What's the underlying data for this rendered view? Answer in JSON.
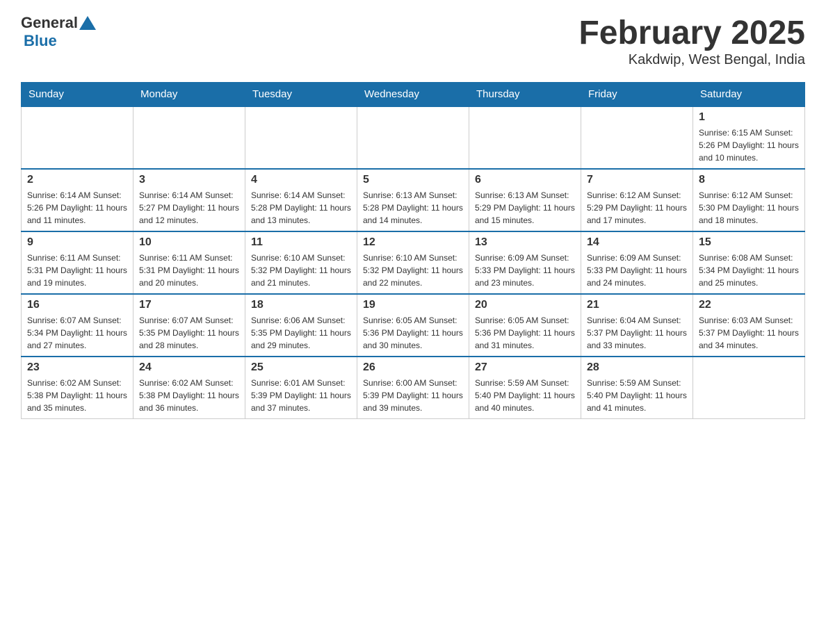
{
  "header": {
    "logo_general": "General",
    "logo_blue": "Blue",
    "title": "February 2025",
    "subtitle": "Kakdwip, West Bengal, India"
  },
  "weekdays": [
    "Sunday",
    "Monday",
    "Tuesday",
    "Wednesday",
    "Thursday",
    "Friday",
    "Saturday"
  ],
  "weeks": [
    [
      {
        "day": "",
        "info": ""
      },
      {
        "day": "",
        "info": ""
      },
      {
        "day": "",
        "info": ""
      },
      {
        "day": "",
        "info": ""
      },
      {
        "day": "",
        "info": ""
      },
      {
        "day": "",
        "info": ""
      },
      {
        "day": "1",
        "info": "Sunrise: 6:15 AM\nSunset: 5:26 PM\nDaylight: 11 hours and 10 minutes."
      }
    ],
    [
      {
        "day": "2",
        "info": "Sunrise: 6:14 AM\nSunset: 5:26 PM\nDaylight: 11 hours and 11 minutes."
      },
      {
        "day": "3",
        "info": "Sunrise: 6:14 AM\nSunset: 5:27 PM\nDaylight: 11 hours and 12 minutes."
      },
      {
        "day": "4",
        "info": "Sunrise: 6:14 AM\nSunset: 5:28 PM\nDaylight: 11 hours and 13 minutes."
      },
      {
        "day": "5",
        "info": "Sunrise: 6:13 AM\nSunset: 5:28 PM\nDaylight: 11 hours and 14 minutes."
      },
      {
        "day": "6",
        "info": "Sunrise: 6:13 AM\nSunset: 5:29 PM\nDaylight: 11 hours and 15 minutes."
      },
      {
        "day": "7",
        "info": "Sunrise: 6:12 AM\nSunset: 5:29 PM\nDaylight: 11 hours and 17 minutes."
      },
      {
        "day": "8",
        "info": "Sunrise: 6:12 AM\nSunset: 5:30 PM\nDaylight: 11 hours and 18 minutes."
      }
    ],
    [
      {
        "day": "9",
        "info": "Sunrise: 6:11 AM\nSunset: 5:31 PM\nDaylight: 11 hours and 19 minutes."
      },
      {
        "day": "10",
        "info": "Sunrise: 6:11 AM\nSunset: 5:31 PM\nDaylight: 11 hours and 20 minutes."
      },
      {
        "day": "11",
        "info": "Sunrise: 6:10 AM\nSunset: 5:32 PM\nDaylight: 11 hours and 21 minutes."
      },
      {
        "day": "12",
        "info": "Sunrise: 6:10 AM\nSunset: 5:32 PM\nDaylight: 11 hours and 22 minutes."
      },
      {
        "day": "13",
        "info": "Sunrise: 6:09 AM\nSunset: 5:33 PM\nDaylight: 11 hours and 23 minutes."
      },
      {
        "day": "14",
        "info": "Sunrise: 6:09 AM\nSunset: 5:33 PM\nDaylight: 11 hours and 24 minutes."
      },
      {
        "day": "15",
        "info": "Sunrise: 6:08 AM\nSunset: 5:34 PM\nDaylight: 11 hours and 25 minutes."
      }
    ],
    [
      {
        "day": "16",
        "info": "Sunrise: 6:07 AM\nSunset: 5:34 PM\nDaylight: 11 hours and 27 minutes."
      },
      {
        "day": "17",
        "info": "Sunrise: 6:07 AM\nSunset: 5:35 PM\nDaylight: 11 hours and 28 minutes."
      },
      {
        "day": "18",
        "info": "Sunrise: 6:06 AM\nSunset: 5:35 PM\nDaylight: 11 hours and 29 minutes."
      },
      {
        "day": "19",
        "info": "Sunrise: 6:05 AM\nSunset: 5:36 PM\nDaylight: 11 hours and 30 minutes."
      },
      {
        "day": "20",
        "info": "Sunrise: 6:05 AM\nSunset: 5:36 PM\nDaylight: 11 hours and 31 minutes."
      },
      {
        "day": "21",
        "info": "Sunrise: 6:04 AM\nSunset: 5:37 PM\nDaylight: 11 hours and 33 minutes."
      },
      {
        "day": "22",
        "info": "Sunrise: 6:03 AM\nSunset: 5:37 PM\nDaylight: 11 hours and 34 minutes."
      }
    ],
    [
      {
        "day": "23",
        "info": "Sunrise: 6:02 AM\nSunset: 5:38 PM\nDaylight: 11 hours and 35 minutes."
      },
      {
        "day": "24",
        "info": "Sunrise: 6:02 AM\nSunset: 5:38 PM\nDaylight: 11 hours and 36 minutes."
      },
      {
        "day": "25",
        "info": "Sunrise: 6:01 AM\nSunset: 5:39 PM\nDaylight: 11 hours and 37 minutes."
      },
      {
        "day": "26",
        "info": "Sunrise: 6:00 AM\nSunset: 5:39 PM\nDaylight: 11 hours and 39 minutes."
      },
      {
        "day": "27",
        "info": "Sunrise: 5:59 AM\nSunset: 5:40 PM\nDaylight: 11 hours and 40 minutes."
      },
      {
        "day": "28",
        "info": "Sunrise: 5:59 AM\nSunset: 5:40 PM\nDaylight: 11 hours and 41 minutes."
      },
      {
        "day": "",
        "info": ""
      }
    ]
  ]
}
